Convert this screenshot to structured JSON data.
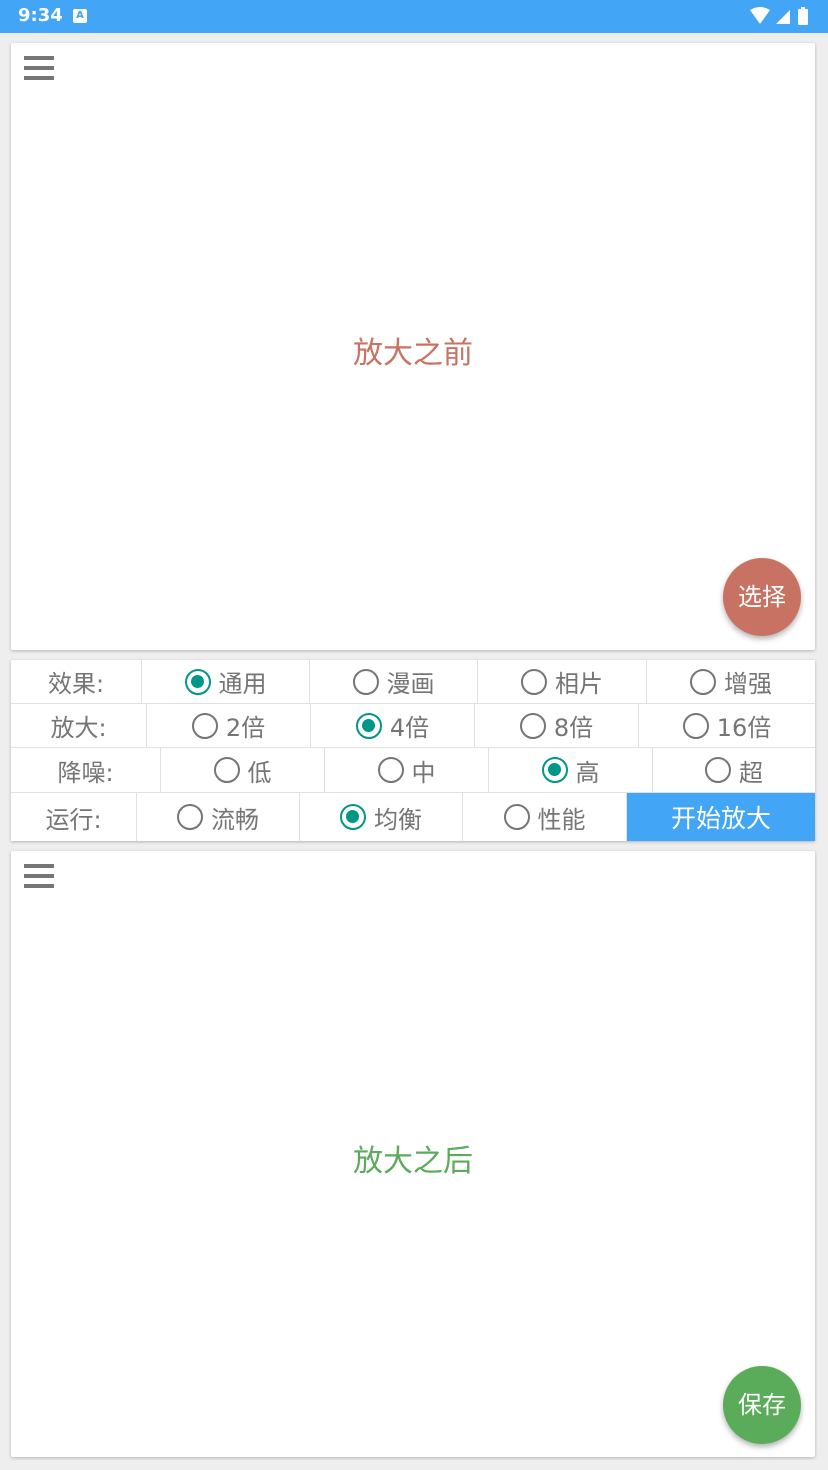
{
  "status_bar": {
    "time": "9:34",
    "notification_icon": "A"
  },
  "top_panel": {
    "menu_icon": "hamburger-menu-icon",
    "label": "放大之前",
    "label_color": "#c87264",
    "fab_label": "选择",
    "fab_color": "#c87264"
  },
  "options": {
    "effect": {
      "label": "效果:",
      "items": [
        {
          "label": "通用",
          "checked": true
        },
        {
          "label": "漫画",
          "checked": false
        },
        {
          "label": "相片",
          "checked": false
        },
        {
          "label": "增强",
          "checked": false
        }
      ]
    },
    "scale": {
      "label": "放大:",
      "items": [
        {
          "label": "2倍",
          "checked": false
        },
        {
          "label": "4倍",
          "checked": true
        },
        {
          "label": "8倍",
          "checked": false
        },
        {
          "label": "16倍",
          "checked": false
        }
      ]
    },
    "denoise": {
      "label": "降噪:",
      "items": [
        {
          "label": "低",
          "checked": false
        },
        {
          "label": "中",
          "checked": false
        },
        {
          "label": "高",
          "checked": true
        },
        {
          "label": "超",
          "checked": false
        }
      ]
    },
    "run": {
      "label": "运行:",
      "items": [
        {
          "label": "流畅",
          "checked": false
        },
        {
          "label": "均衡",
          "checked": true
        },
        {
          "label": "性能",
          "checked": false
        }
      ],
      "start_button": "开始放大"
    }
  },
  "bottom_panel": {
    "menu_icon": "hamburger-menu-icon",
    "label": "放大之后",
    "label_color": "#5aab5a",
    "fab_label": "保存",
    "fab_color": "#5aab5a"
  },
  "colors": {
    "accent": "#009688",
    "status_bar": "#42a5f5",
    "button": "#42a5f5"
  }
}
